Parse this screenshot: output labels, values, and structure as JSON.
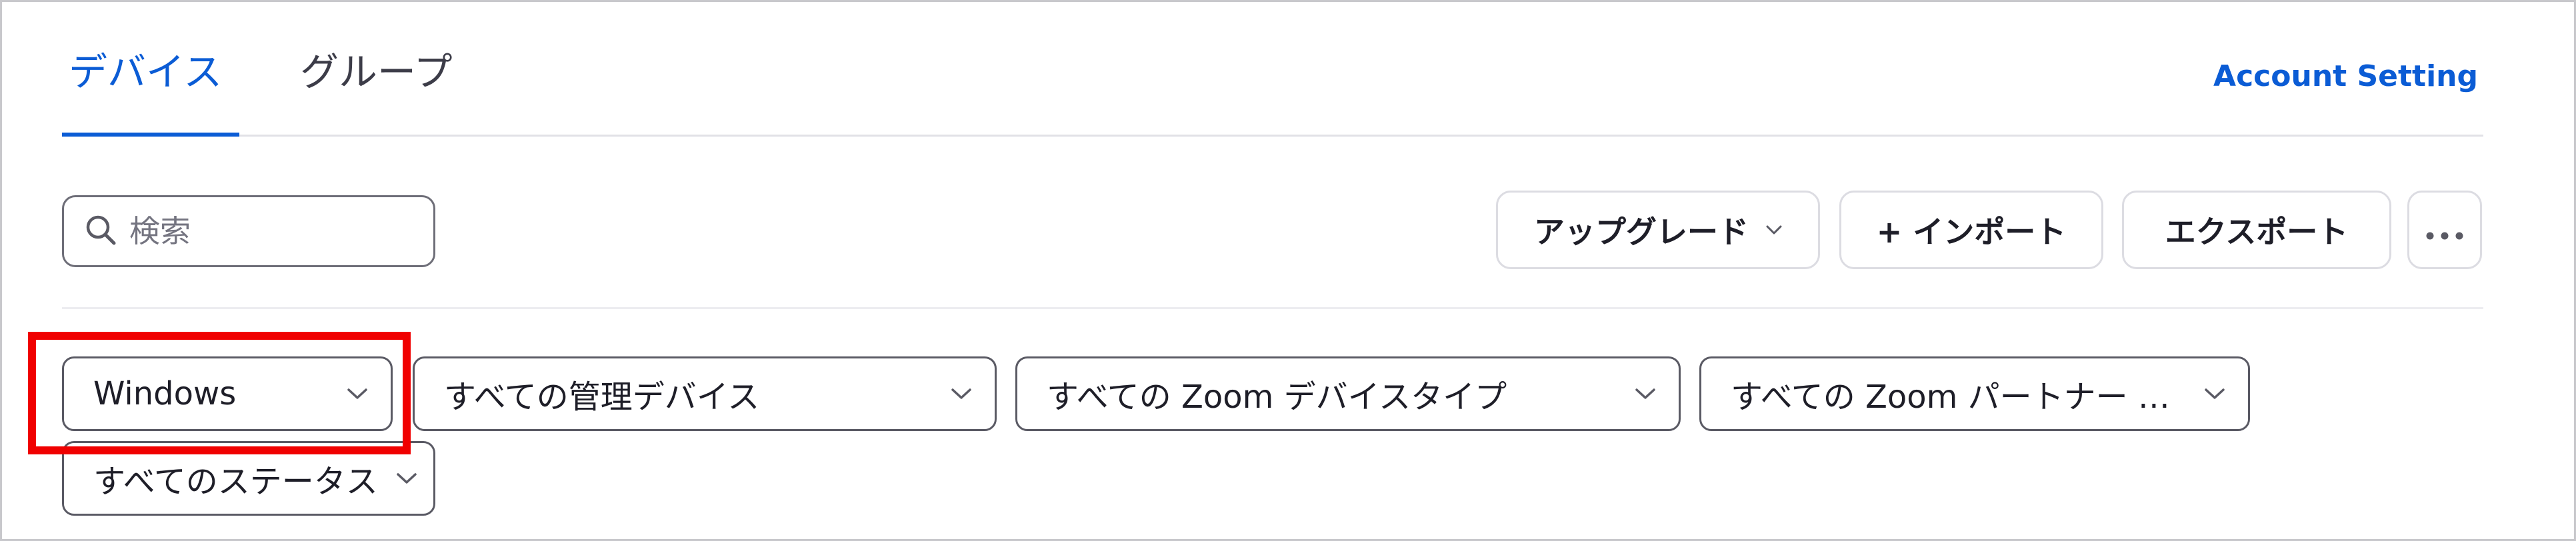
{
  "tabs": {
    "devices": "デバイス",
    "groups": "グループ",
    "active": "devices"
  },
  "header": {
    "account_setting": "Account Setting"
  },
  "search": {
    "placeholder": "検索",
    "value": ""
  },
  "toolbar": {
    "upgrade_label": "アップグレード",
    "import_label": "+ インポート",
    "export_label": "エクスポート",
    "more_label": "•••"
  },
  "filters": {
    "os": "Windows",
    "managed": "すべての管理デバイス",
    "device_type": "すべての Zoom デバイスタイプ",
    "partner": "すべての Zoom パートナー …",
    "status": "すべてのステータス"
  },
  "icons": {
    "search": "search-icon",
    "dropdown": "chevron-down-icon",
    "more": "more-horizontal-icon"
  },
  "colors": {
    "accent": "#0b5cd5",
    "highlight": "#f00000",
    "border": "#5a5a64"
  }
}
